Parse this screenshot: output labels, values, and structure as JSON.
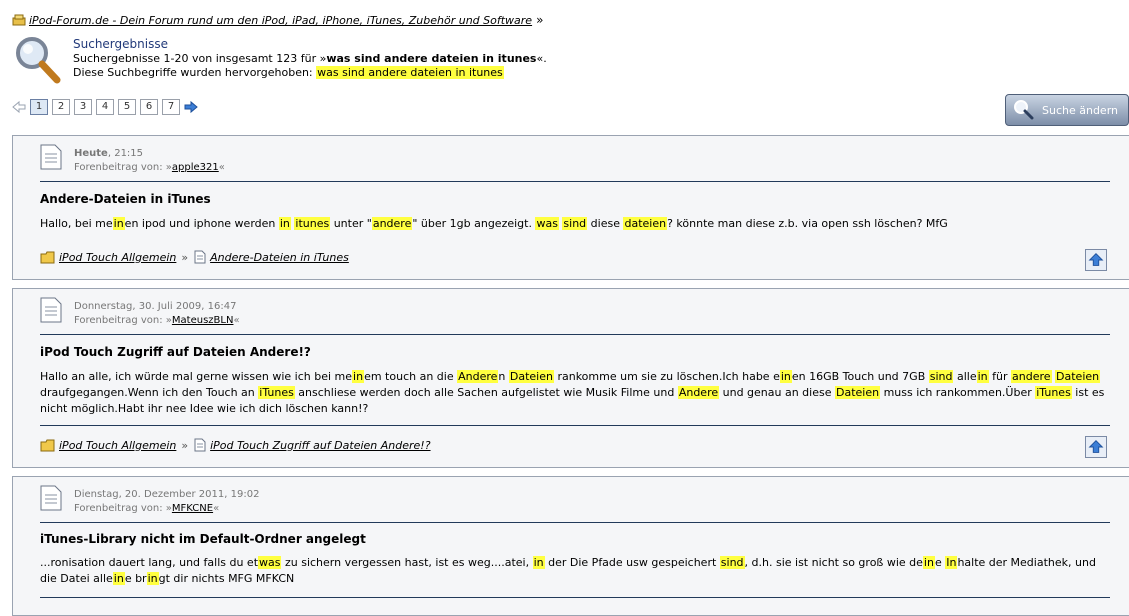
{
  "breadcrumb": {
    "link": "iPod-Forum.de - Dein Forum rund um den iPod, iPad, iPhone, iTunes, Zubehör und Software",
    "separator": "»"
  },
  "header": {
    "title": "Suchergebnisse",
    "summary_prefix": "Suchergebnisse 1-20 von insgesamt 123 für »",
    "summary_term": "was sind andere dateien in itunes",
    "summary_suffix": "«.",
    "highlight_prefix": "Diese Suchbegriffe wurden hervorgehoben: ",
    "highlight_term": "was sind andere dateien in itunes"
  },
  "pagination": {
    "pages": [
      "1",
      "2",
      "3",
      "4",
      "5",
      "6",
      "7"
    ],
    "active_index": 0
  },
  "search_change_button": {
    "label": "Suche ändern"
  },
  "results": [
    {
      "date": "Heute",
      "time": ", 21:15",
      "author_prefix": "Forenbeitrag von: »",
      "author": "apple321",
      "author_suffix": "«",
      "title": "Andere-Dateien in iTunes",
      "snippet": [
        {
          "t": "Hallo, bei me"
        },
        {
          "t": "in",
          "h": true
        },
        {
          "t": "en ipod und iphone werden "
        },
        {
          "t": "in",
          "h": true
        },
        {
          "t": " "
        },
        {
          "t": "itunes",
          "h": true
        },
        {
          "t": " unter \""
        },
        {
          "t": "andere",
          "h": true
        },
        {
          "t": "\" über 1gb angezeigt. "
        },
        {
          "t": "was",
          "h": true
        },
        {
          "t": " "
        },
        {
          "t": "sind",
          "h": true
        },
        {
          "t": " diese "
        },
        {
          "t": "dateien",
          "h": true
        },
        {
          "t": "? könnte man diese z.b. via open ssh löschen? MfG"
        }
      ],
      "forum": "iPod Touch Allgemein",
      "separator": "»",
      "thread": "Andere-Dateien in iTunes"
    },
    {
      "date": "Donnerstag, 30. Juli 2009, 16:47",
      "time": "",
      "author_prefix": "Forenbeitrag von: »",
      "author": "MateuszBLN",
      "author_suffix": "«",
      "title": "iPod Touch Zugriff auf Dateien Andere!?",
      "snippet": [
        {
          "t": "Hallo an alle, ich würde mal gerne wissen wie ich bei me"
        },
        {
          "t": "in",
          "h": true
        },
        {
          "t": "em touch an die "
        },
        {
          "t": "Andere",
          "h": true
        },
        {
          "t": "n "
        },
        {
          "t": "Dateien",
          "h": true
        },
        {
          "t": " rankomme um sie zu löschen.Ich habe e"
        },
        {
          "t": "in",
          "h": true
        },
        {
          "t": "en 16GB Touch und 7GB "
        },
        {
          "t": "sind",
          "h": true
        },
        {
          "t": " alle"
        },
        {
          "t": "in",
          "h": true
        },
        {
          "t": " für "
        },
        {
          "t": "andere",
          "h": true
        },
        {
          "t": " "
        },
        {
          "t": "Dateien",
          "h": true
        },
        {
          "t": " draufgegangen.Wenn ich den Touch an "
        },
        {
          "t": "iTunes",
          "h": true
        },
        {
          "t": " anschliese werden doch alle Sachen aufgelistet wie Musik Filme und "
        },
        {
          "t": "Andere",
          "h": true
        },
        {
          "t": " und genau an diese "
        },
        {
          "t": "Dateien",
          "h": true
        },
        {
          "t": " muss ich rankommen.Über "
        },
        {
          "t": "iTunes",
          "h": true
        },
        {
          "t": " ist es nicht möglich.Habt ihr nee Idee wie ich dich löschen kann!?"
        }
      ],
      "forum": "iPod Touch Allgemein",
      "separator": "»",
      "thread": "iPod Touch Zugriff auf Dateien Andere!?"
    },
    {
      "date": "Dienstag, 20. Dezember 2011, 19:02",
      "time": "",
      "author_prefix": "Forenbeitrag von: »",
      "author": "MFKCNE",
      "author_suffix": "«",
      "title": "iTunes-Library nicht im Default-Ordner angelegt",
      "snippet": [
        {
          "t": "...ronisation dauert lang, und falls du et"
        },
        {
          "t": "was",
          "h": true
        },
        {
          "t": " zu sichern vergessen hast, ist es weg....atei, "
        },
        {
          "t": "in",
          "h": true
        },
        {
          "t": " der Die Pfade usw gespeichert "
        },
        {
          "t": "sind",
          "h": true
        },
        {
          "t": ", d.h. sie ist nicht so groß wie de"
        },
        {
          "t": "in",
          "h": true
        },
        {
          "t": "e "
        },
        {
          "t": "In",
          "h": true
        },
        {
          "t": "halte der Mediathek, und die Datei alle"
        },
        {
          "t": "in",
          "h": true
        },
        {
          "t": "e br"
        },
        {
          "t": "in",
          "h": true
        },
        {
          "t": "gt dir nichts MFG MFKCN"
        }
      ]
    }
  ]
}
